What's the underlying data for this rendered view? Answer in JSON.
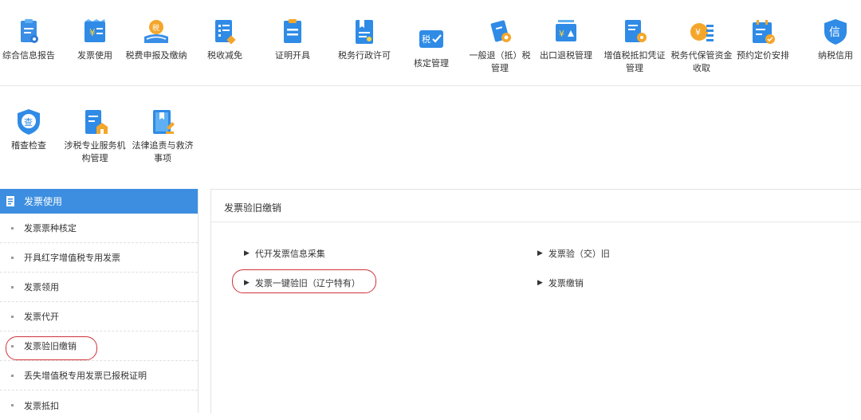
{
  "tiles_row1": [
    {
      "label": "综合信息报告",
      "icon": "report-icon"
    },
    {
      "label": "发票使用",
      "icon": "invoice-icon"
    },
    {
      "label": "税费申报及缴纳",
      "icon": "tax-payment-icon"
    },
    {
      "label": "税收减免",
      "icon": "tax-relief-icon"
    },
    {
      "label": "证明开具",
      "icon": "certificate-icon"
    },
    {
      "label": "税务行政许可",
      "icon": "permit-icon"
    },
    {
      "label": "核定管理",
      "icon": "assessment-icon"
    },
    {
      "label": "一般退（抵）税管理",
      "icon": "refund-icon"
    },
    {
      "label": "出口退税管理",
      "icon": "export-refund-icon"
    },
    {
      "label": "增值税抵扣凭证管理",
      "icon": "vat-deduction-icon"
    },
    {
      "label": "税务代保管资金收取",
      "icon": "custody-fund-icon"
    },
    {
      "label": "预约定价安排",
      "icon": "pricing-icon"
    },
    {
      "label": "纳税信用",
      "icon": "credit-icon"
    }
  ],
  "tiles_row2": [
    {
      "label": "稽查检查",
      "icon": "inspection-icon"
    },
    {
      "label": "涉税专业服务机构管理",
      "icon": "agency-icon"
    },
    {
      "label": "法律追责与救济事项",
      "icon": "legal-icon"
    }
  ],
  "sidebar": {
    "title": "发票使用",
    "items": [
      "发票票种核定",
      "开具红字增值税专用发票",
      "发票领用",
      "发票代开",
      "发票验旧缴销",
      "丢失增值税专用发票已报税证明",
      "发票抵扣"
    ]
  },
  "panel": {
    "title": "发票验旧缴销",
    "links": [
      "代开发票信息采集",
      "发票验（交）旧",
      "发票一键验旧（辽宁特有）",
      "发票缴销"
    ]
  },
  "colors": {
    "accent": "#3d8ee0",
    "highlight": "#d0333a"
  }
}
